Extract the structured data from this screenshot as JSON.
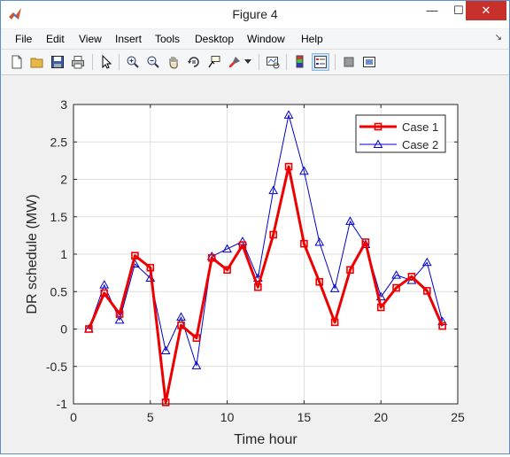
{
  "window": {
    "title": "Figure 4"
  },
  "controls": {
    "minimize": "—",
    "maximize": "☐",
    "close": "✕"
  },
  "menu": [
    "File",
    "Edit",
    "View",
    "Insert",
    "Tools",
    "Desktop",
    "Window",
    "Help"
  ],
  "menu_extra": "↘",
  "toolbar": {
    "icons": [
      "new-figure-icon",
      "open-file-icon",
      "save-icon",
      "print-icon",
      "edit-plot-arrow-icon",
      "zoom-in-icon",
      "zoom-out-icon",
      "pan-hand-icon",
      "rotate-3d-icon",
      "data-cursor-icon",
      "brush-icon",
      "brush-dropdown-icon",
      "link-plot-icon",
      "insert-colorbar-icon",
      "insert-legend-icon",
      "hide-plot-tools-icon",
      "show-plot-tools-icon"
    ],
    "active": "insert-legend-icon"
  },
  "chart_data": {
    "type": "line",
    "xlabel": "Time hour",
    "ylabel": "DR schedule (MW)",
    "xlim": [
      0,
      25
    ],
    "ylim": [
      -1,
      3
    ],
    "xticks": [
      "0",
      "5",
      "10",
      "15",
      "20",
      "25"
    ],
    "yticks": [
      "-1",
      "-0.5",
      "0",
      "0.5",
      "1",
      "1.5",
      "2",
      "2.5",
      "3"
    ],
    "grid": true,
    "legend_position": "top-right",
    "x": [
      1,
      2,
      3,
      4,
      5,
      6,
      7,
      8,
      9,
      10,
      11,
      12,
      13,
      14,
      15,
      16,
      17,
      18,
      19,
      20,
      21,
      22,
      23,
      24
    ],
    "series": [
      {
        "name": "Case 1",
        "color": "#ee0000",
        "marker": "square",
        "values": [
          0,
          0.48,
          0.2,
          0.98,
          0.82,
          -0.98,
          0.05,
          -0.12,
          0.95,
          0.79,
          1.12,
          0.56,
          1.26,
          2.17,
          1.14,
          0.63,
          0.09,
          0.79,
          1.16,
          0.29,
          0.55,
          0.7,
          0.51,
          0.04
        ]
      },
      {
        "name": "Case 2",
        "color": "#0000cc",
        "marker": "triangle",
        "values": [
          0,
          0.59,
          0.12,
          0.87,
          0.68,
          -0.29,
          0.16,
          -0.49,
          0.97,
          1.07,
          1.17,
          0.68,
          1.85,
          2.86,
          2.11,
          1.16,
          0.54,
          1.44,
          1.13,
          0.43,
          0.72,
          0.65,
          0.89,
          0.1
        ]
      }
    ]
  }
}
